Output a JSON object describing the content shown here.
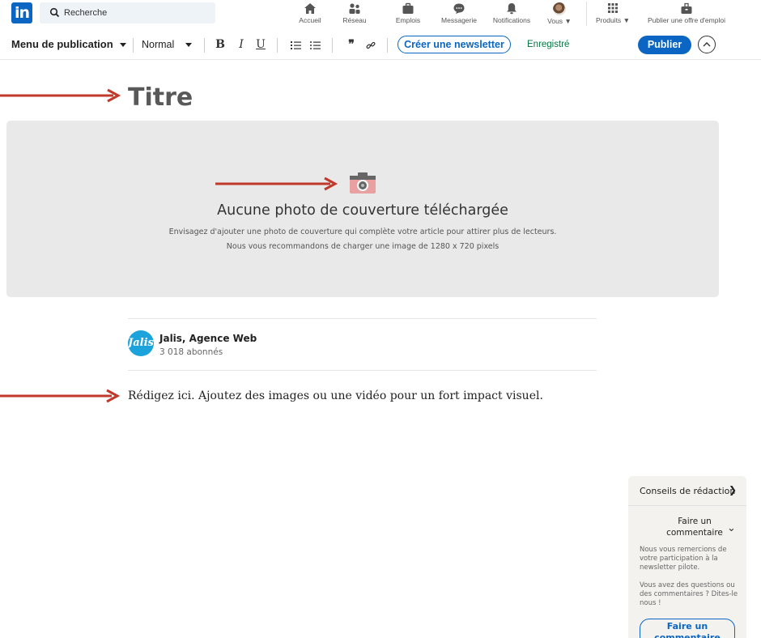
{
  "topnav": {
    "logo": "in",
    "search": {
      "placeholder": "Recherche",
      "value": ""
    },
    "items": [
      {
        "label": "Accueil",
        "icon": "home-icon"
      },
      {
        "label": "Réseau",
        "icon": "network-icon"
      },
      {
        "label": "Emplois",
        "icon": "briefcase-icon"
      },
      {
        "label": "Messagerie",
        "icon": "messaging-icon"
      },
      {
        "label": "Notifications",
        "icon": "bell-icon"
      },
      {
        "label": "Vous",
        "icon": "avatar"
      },
      {
        "label": "Produits",
        "icon": "grid-icon"
      },
      {
        "label": "Publier une offre d'emploi",
        "icon": "post-job-icon"
      }
    ]
  },
  "toolbar": {
    "menu_label": "Menu de publication",
    "style_label": "Normal",
    "format_buttons": [
      "B",
      "I",
      "U"
    ],
    "newsletter_label": "Créer une newsletter",
    "saved_label": "Enregistré",
    "publish_label": "Publier"
  },
  "article": {
    "title": "Titre",
    "cover": {
      "heading": "Aucune photo de couverture téléchargée",
      "line1": "Envisagez d'ajouter une photo de couverture qui complète votre article pour attirer plus de lecteurs.",
      "line2": "Nous vous recommandons de charger une image de 1280 x 720 pixels"
    },
    "author": {
      "logo_text": "Jalis",
      "name": "Jalis, Agence Web",
      "subscribers": "3 018 abonnés"
    },
    "body_placeholder": "Rédigez ici. Ajoutez des images ou une vidéo pour un fort impact visuel."
  },
  "tips": {
    "header": "Conseils de rédaction",
    "section_title_1": "Faire un",
    "section_title_2": "commentaire",
    "para1": "Nous vous remercions de votre participation à la newsletter pilote.",
    "para2": "Vous avez des questions ou des commentaires ? Dites-le nous !",
    "button_label_1": "Faire un",
    "button_label_2": "commentaire"
  },
  "colors": {
    "brand_blue": "#0a66c2",
    "arrow_red": "#c0392b",
    "saved_green": "#057642"
  }
}
